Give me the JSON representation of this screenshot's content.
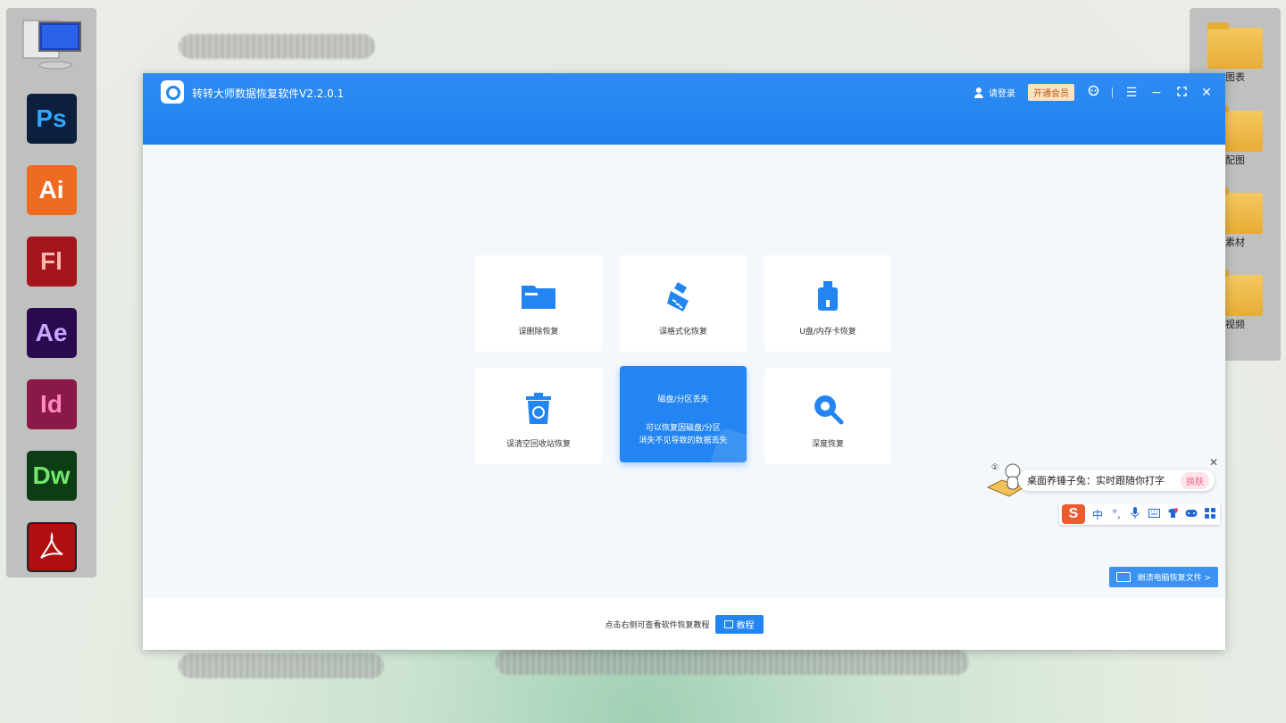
{
  "window": {
    "title": "转转大师数据恢复软件V2.2.0.1",
    "login_label": "请登录",
    "vip_label": "开通会员",
    "colors": {
      "primary": "#2385f1",
      "vip_bg": "#fde3c4"
    }
  },
  "cards": [
    {
      "label": "误删除恢复",
      "icon": "folder-icon"
    },
    {
      "label": "误格式化恢复",
      "icon": "broom-icon"
    },
    {
      "label": "U盘/内存卡恢复",
      "icon": "usb-drive-icon"
    },
    {
      "label": "误清空回收站恢复",
      "icon": "recycle-bin-icon"
    },
    {
      "label": "磁盘/分区丢失",
      "desc_line1": "可以恢复因磁盘/分区",
      "desc_line2": "消失不见导致的数据丢失",
      "icon": "disk-icon",
      "active": true
    },
    {
      "label": "深度恢复",
      "icon": "magnifier-icon"
    }
  ],
  "footer": {
    "hint": "点击右侧可查看软件恢复教程",
    "tutorial_label": "教程"
  },
  "crash_recover_label": "崩溃电脑恢复文件 >",
  "ime": {
    "bubble_text": "桌面养锤子兔：实时跟随你打字",
    "skin_label": "换肤",
    "badge_number": "①",
    "toolbar": [
      "中",
      "°,"
    ]
  },
  "desktop": {
    "left_apps": [
      "Ps",
      "Ai",
      "Fl",
      "Ae",
      "Id",
      "Dw"
    ],
    "folders": [
      "图表",
      "配图",
      "素材",
      "视频"
    ]
  }
}
